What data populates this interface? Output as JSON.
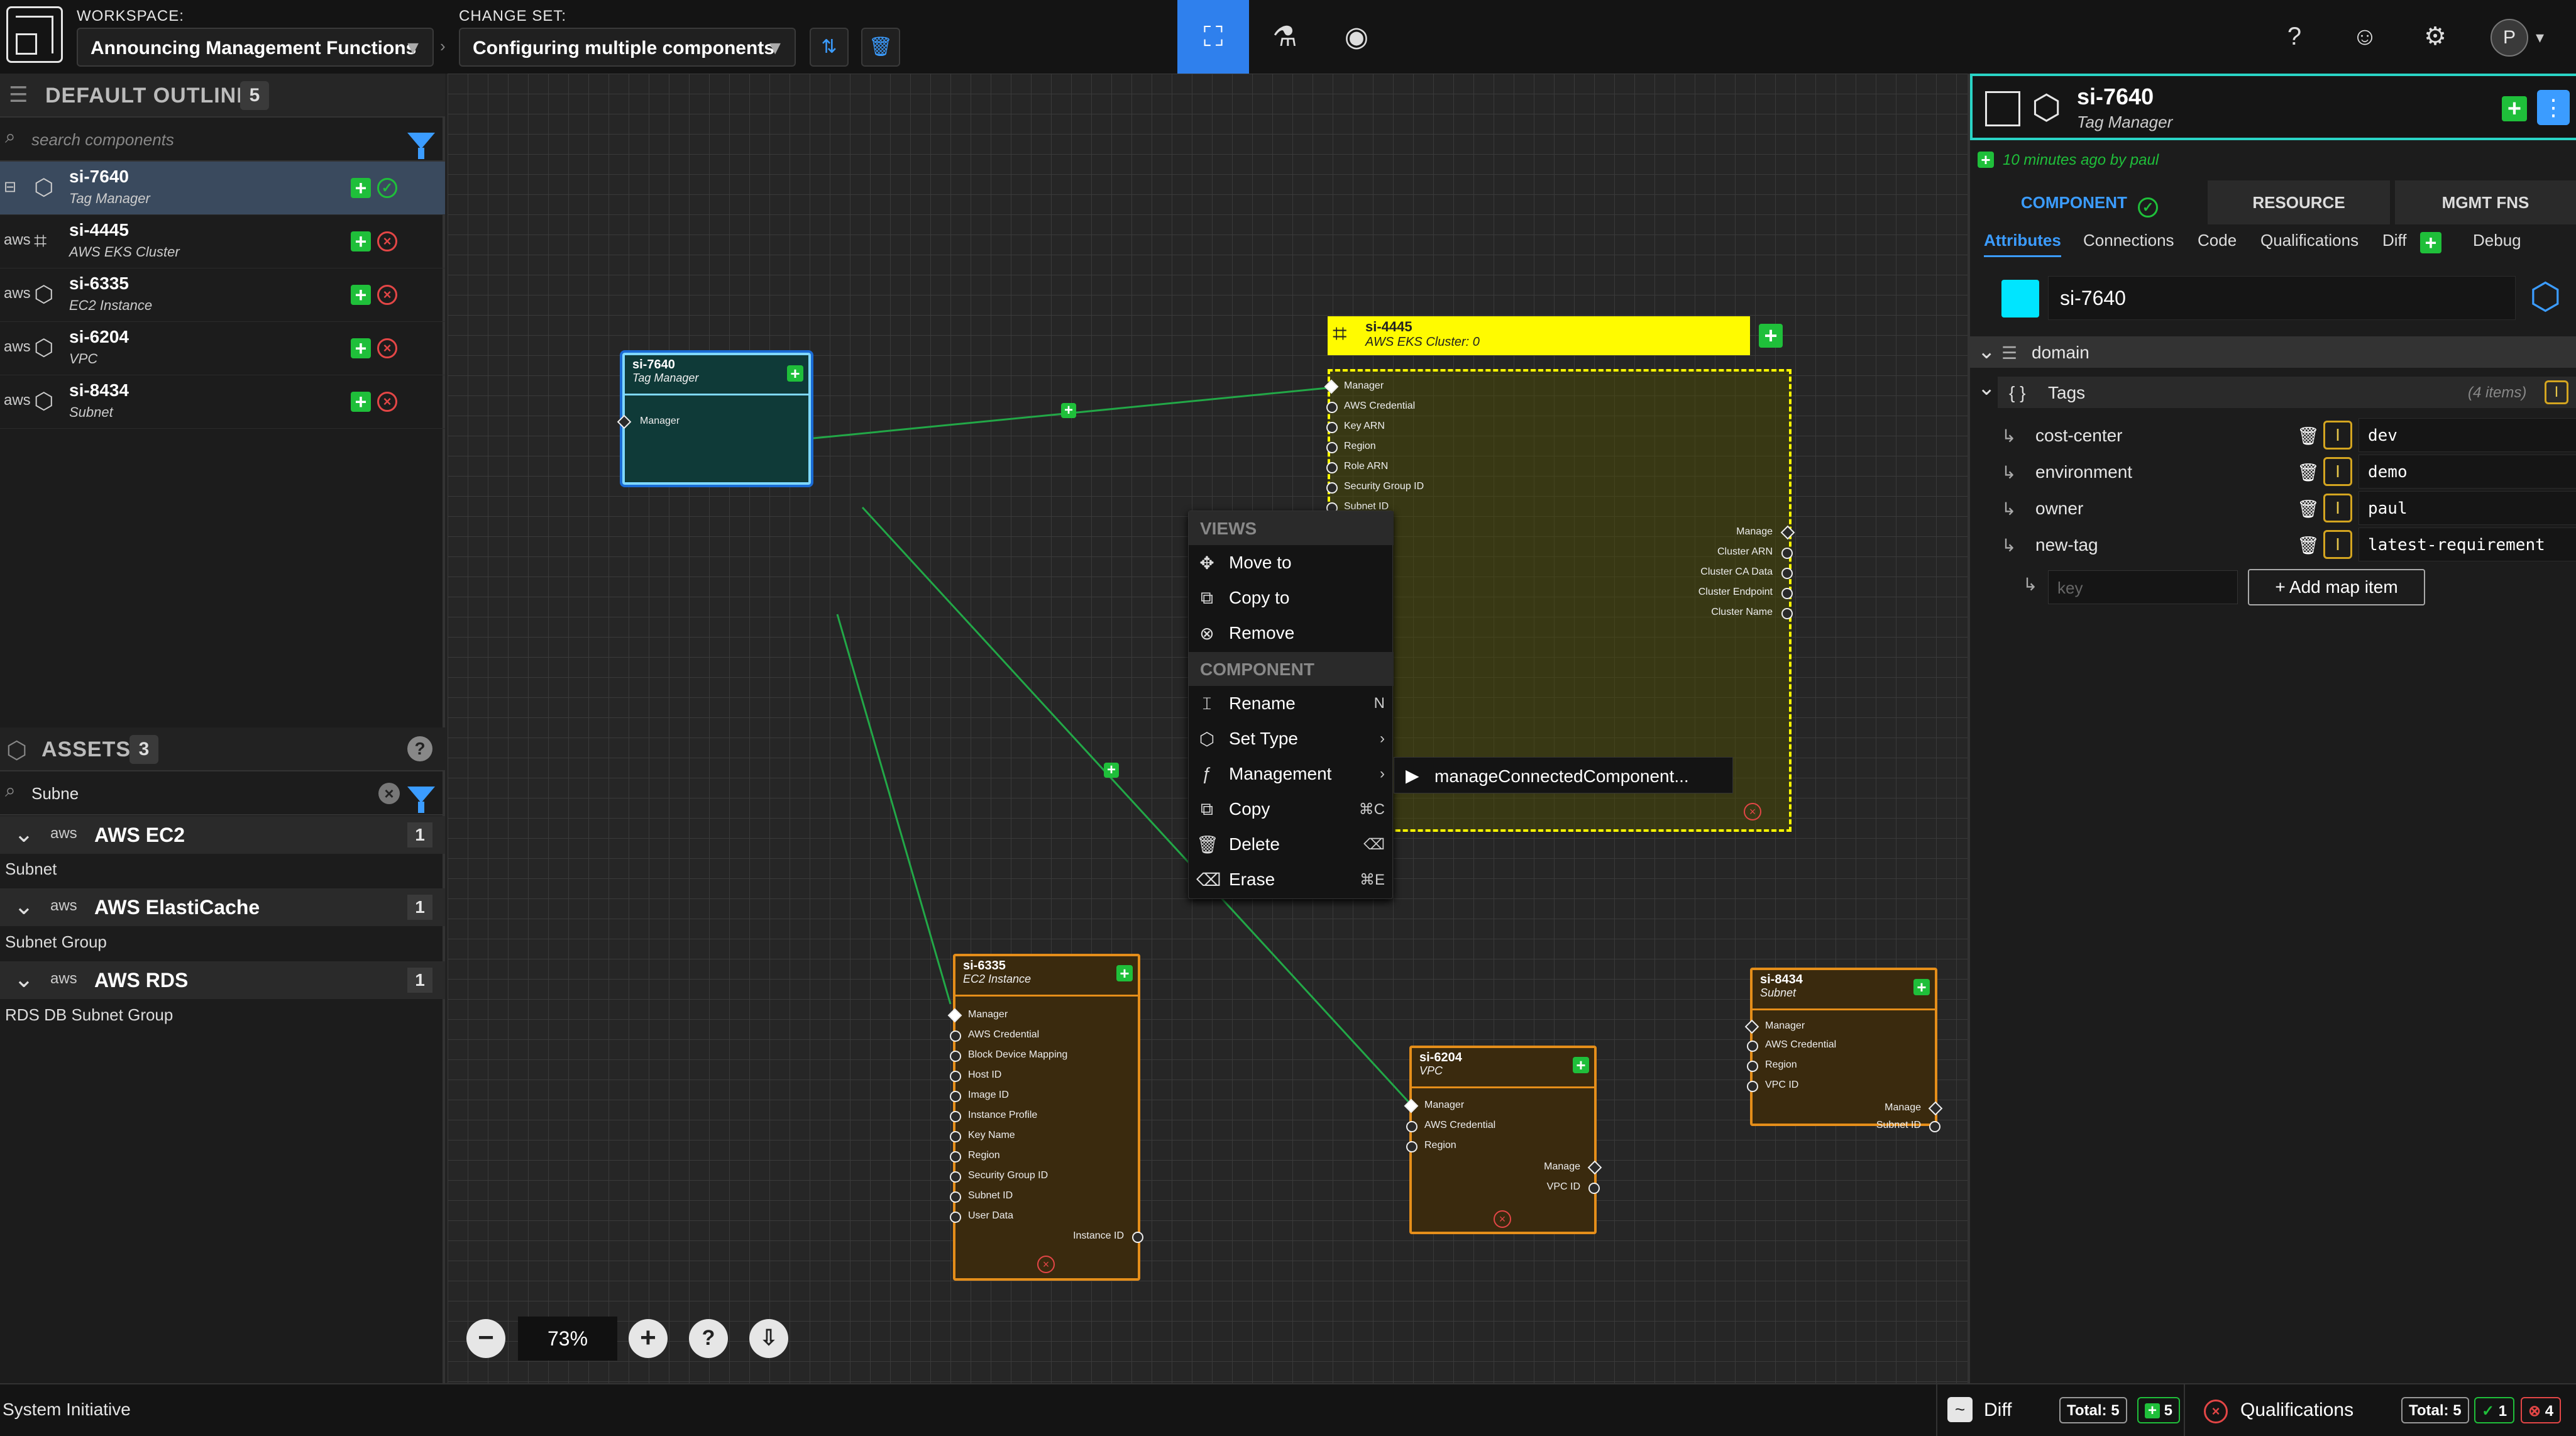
{
  "workspace": {
    "label": "WORKSPACE:",
    "value": "Announcing Management Functions"
  },
  "changeset": {
    "label": "CHANGE SET:",
    "value": "Configuring multiple components"
  },
  "user": {
    "initial": "P"
  },
  "outline": {
    "title": "DEFAULT OUTLINE",
    "count": "5",
    "search_placeholder": "search components",
    "items": [
      {
        "name": "si-7640",
        "type": "Tag Manager"
      },
      {
        "name": "si-4445",
        "type": "AWS EKS Cluster"
      },
      {
        "name": "si-6335",
        "type": "EC2 Instance"
      },
      {
        "name": "si-6204",
        "type": "VPC"
      },
      {
        "name": "si-8434",
        "type": "Subnet"
      }
    ]
  },
  "assets": {
    "title": "ASSETS",
    "count": "3",
    "search_value": "Subne",
    "groups": [
      {
        "name": "AWS EC2",
        "count": "1",
        "item": "Subnet"
      },
      {
        "name": "AWS ElastiCache",
        "count": "1",
        "item": "Subnet Group"
      },
      {
        "name": "AWS RDS",
        "count": "1",
        "item": "RDS DB Subnet Group"
      }
    ]
  },
  "aws_label": "aws",
  "nodes": {
    "tagmgr": {
      "name": "si-7640",
      "type": "Tag Manager",
      "sockets": [
        "Manager"
      ]
    },
    "eks": {
      "name": "si-4445",
      "type": "AWS EKS Cluster: 0",
      "inputs": [
        "Manager",
        "AWS Credential",
        "Key ARN",
        "Region",
        "Role ARN",
        "Security Group ID",
        "Subnet ID"
      ],
      "outputs": [
        "Manage",
        "Cluster ARN",
        "Cluster CA Data",
        "Cluster Endpoint",
        "Cluster Name"
      ]
    },
    "ec2": {
      "name": "si-6335",
      "type": "EC2 Instance",
      "inputs": [
        "Manager",
        "AWS Credential",
        "Block Device Mapping",
        "Host ID",
        "Image ID",
        "Instance Profile",
        "Key Name",
        "Region",
        "Security Group ID",
        "Subnet ID",
        "User Data"
      ],
      "outputs": [
        "Instance ID"
      ]
    },
    "vpc": {
      "name": "si-6204",
      "type": "VPC",
      "inputs": [
        "Manager",
        "AWS Credential",
        "Region"
      ],
      "outputs": [
        "Manage",
        "VPC ID"
      ]
    },
    "subnet": {
      "name": "si-8434",
      "type": "Subnet",
      "inputs": [
        "Manager",
        "AWS Credential",
        "Region",
        "VPC ID"
      ],
      "outputs": [
        "Manage",
        "Subnet ID"
      ]
    }
  },
  "context_menu": {
    "views_label": "VIEWS",
    "component_label": "COMPONENT",
    "move": "Move to",
    "copyto": "Copy to",
    "remove": "Remove",
    "rename": "Rename",
    "rename_key": "N",
    "settype": "Set Type",
    "management": "Management",
    "copy": "Copy",
    "copy_key": "⌘C",
    "delete": "Delete",
    "delete_key": "⌫",
    "erase": "Erase",
    "erase_key": "⌘E",
    "submenu_item": "manageConnectedComponent..."
  },
  "zoom": "73%",
  "detail": {
    "name": "si-7640",
    "type": "Tag Manager",
    "timestamp": "10 minutes ago by paul",
    "tabs": [
      "COMPONENT",
      "RESOURCE",
      "MGMT FNS"
    ],
    "subtabs": [
      "Attributes",
      "Connections",
      "Code",
      "Qualifications",
      "Diff",
      "Debug"
    ],
    "name_value": "si-7640",
    "color": "#00e5ff",
    "domain_label": "domain",
    "tags_label": "Tags",
    "tags_count": "(4 items)",
    "tags": [
      {
        "key": "cost-center",
        "value": "dev"
      },
      {
        "key": "environment",
        "value": "demo"
      },
      {
        "key": "owner",
        "value": "paul"
      },
      {
        "key": "new-tag",
        "value": "latest-requirement"
      }
    ],
    "key_placeholder": "key",
    "add_map_item": "+ Add map item"
  },
  "status": {
    "app": "System Initiative",
    "diff": "Diff",
    "diff_total": "Total: 5",
    "diff_added": "5",
    "qual": "Qualifications",
    "qual_total": "Total: 5",
    "qual_ok": "1",
    "qual_fail": "4"
  }
}
